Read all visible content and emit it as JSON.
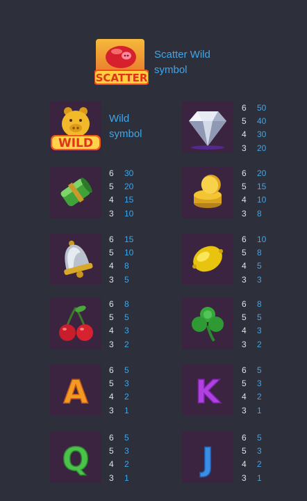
{
  "scatter": {
    "icon": "scatter-piggy-bank-icon",
    "badge": "SCATTER",
    "description": "Scatter Wild symbol"
  },
  "wild": {
    "icon": "wild-pig-icon",
    "badge": "WILD",
    "description": "Wild symbol"
  },
  "symbols": [
    {
      "icon": "diamond-icon",
      "pays": [
        {
          "count": "6",
          "value": "50"
        },
        {
          "count": "5",
          "value": "40"
        },
        {
          "count": "4",
          "value": "30"
        },
        {
          "count": "3",
          "value": "20"
        }
      ]
    },
    {
      "icon": "cash-roll-icon",
      "pays": [
        {
          "count": "6",
          "value": "30"
        },
        {
          "count": "5",
          "value": "20"
        },
        {
          "count": "4",
          "value": "15"
        },
        {
          "count": "3",
          "value": "10"
        }
      ]
    },
    {
      "icon": "gold-coins-icon",
      "pays": [
        {
          "count": "6",
          "value": "20"
        },
        {
          "count": "5",
          "value": "15"
        },
        {
          "count": "4",
          "value": "10"
        },
        {
          "count": "3",
          "value": "8"
        }
      ]
    },
    {
      "icon": "bell-icon",
      "pays": [
        {
          "count": "6",
          "value": "15"
        },
        {
          "count": "5",
          "value": "10"
        },
        {
          "count": "4",
          "value": "8"
        },
        {
          "count": "3",
          "value": "5"
        }
      ]
    },
    {
      "icon": "lemon-icon",
      "pays": [
        {
          "count": "6",
          "value": "10"
        },
        {
          "count": "5",
          "value": "8"
        },
        {
          "count": "4",
          "value": "5"
        },
        {
          "count": "3",
          "value": "3"
        }
      ]
    },
    {
      "icon": "cherries-icon",
      "pays": [
        {
          "count": "6",
          "value": "8"
        },
        {
          "count": "5",
          "value": "5"
        },
        {
          "count": "4",
          "value": "3"
        },
        {
          "count": "3",
          "value": "2"
        }
      ]
    },
    {
      "icon": "clover-icon",
      "pays": [
        {
          "count": "6",
          "value": "8"
        },
        {
          "count": "5",
          "value": "5"
        },
        {
          "count": "4",
          "value": "3"
        },
        {
          "count": "3",
          "value": "2"
        }
      ]
    },
    {
      "icon": "letter-a-icon",
      "letter": "A",
      "pays": [
        {
          "count": "6",
          "value": "5"
        },
        {
          "count": "5",
          "value": "3"
        },
        {
          "count": "4",
          "value": "2"
        },
        {
          "count": "3",
          "value": "1"
        }
      ]
    },
    {
      "icon": "letter-k-icon",
      "letter": "K",
      "pays": [
        {
          "count": "6",
          "value": "5"
        },
        {
          "count": "5",
          "value": "3"
        },
        {
          "count": "4",
          "value": "2"
        },
        {
          "count": "3",
          "value": "1"
        }
      ]
    },
    {
      "icon": "letter-q-icon",
      "letter": "Q",
      "pays": [
        {
          "count": "6",
          "value": "5"
        },
        {
          "count": "5",
          "value": "3"
        },
        {
          "count": "4",
          "value": "2"
        },
        {
          "count": "3",
          "value": "1"
        }
      ]
    },
    {
      "icon": "letter-j-icon",
      "letter": "J",
      "pays": [
        {
          "count": "6",
          "value": "5"
        },
        {
          "count": "5",
          "value": "3"
        },
        {
          "count": "4",
          "value": "2"
        },
        {
          "count": "3",
          "value": "1"
        }
      ]
    }
  ],
  "colors": {
    "background": "#2d2f3a",
    "tile": "#3b2440",
    "accent_blue": "#3fa7ea",
    "count_text": "#e3e3e3"
  }
}
